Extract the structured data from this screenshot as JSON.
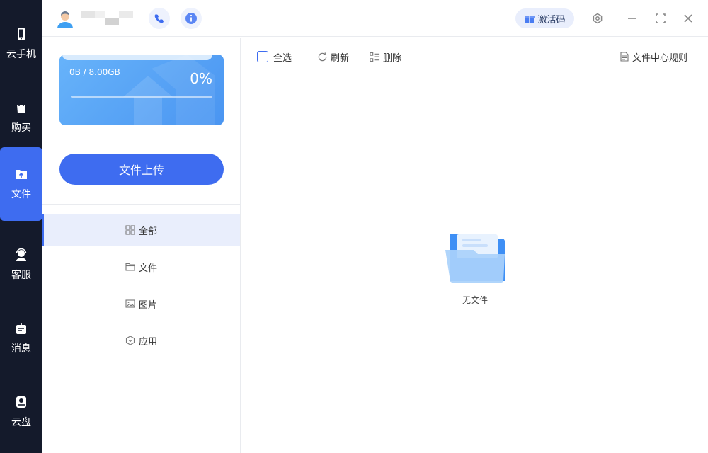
{
  "sidebar": {
    "items": [
      {
        "label": "云手机",
        "icon": "phone-icon"
      },
      {
        "label": "购买",
        "icon": "shopping-bag-icon"
      },
      {
        "label": "文件",
        "icon": "folder-upload-icon"
      },
      {
        "label": "客服",
        "icon": "headset-icon"
      },
      {
        "label": "消息",
        "icon": "message-icon"
      },
      {
        "label": "云盘",
        "icon": "cloud-disk-icon"
      }
    ],
    "active_index": 2
  },
  "header": {
    "activation_label": "激活码",
    "icons": [
      "avatar-icon",
      "phone-call-icon",
      "info-icon",
      "gift-icon",
      "settings-icon",
      "minimize-icon",
      "maximize-icon",
      "close-icon"
    ]
  },
  "storage": {
    "used_text": "0B / 8.00GB",
    "percent_text": "0%",
    "progress_fraction": 0.0
  },
  "upload": {
    "label": "文件上传"
  },
  "categories": [
    {
      "label": "全部",
      "icon": "grid-icon"
    },
    {
      "label": "文件",
      "icon": "folder-icon"
    },
    {
      "label": "图片",
      "icon": "image-icon"
    },
    {
      "label": "应用",
      "icon": "app-box-icon"
    }
  ],
  "toolbar": {
    "select_all": "全选",
    "refresh": "刷新",
    "delete": "删除",
    "rules": "文件中心规则"
  },
  "empty_state": {
    "label": "无文件",
    "icon": "empty-folder-icon"
  },
  "colors": {
    "accent": "#3e6cf0",
    "rail": "#141a2b",
    "card_start": "#67b3fa",
    "card_end": "#4a95f1"
  }
}
